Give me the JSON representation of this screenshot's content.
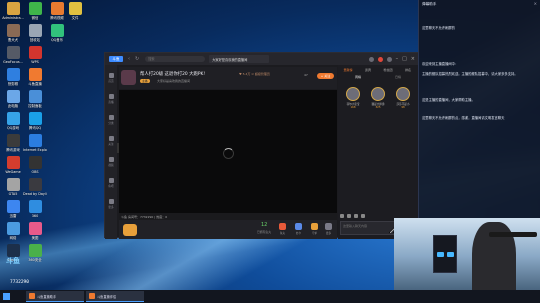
{
  "desktop": {
    "icons": [
      {
        "label": "Administra...",
        "color": "#d9a441"
      },
      {
        "label": "曹犬犬",
        "color": "#8a6a55"
      },
      {
        "label": "GeoFocus...",
        "color": "#555a66"
      },
      {
        "label": "快剪辑",
        "color": "#2f7fe0"
      },
      {
        "label": "此电脑",
        "color": "#6ba7e8"
      },
      {
        "label": "QQ游戏",
        "color": "#36a3e8"
      },
      {
        "label": "腾讯游戏",
        "color": "#3b3b3b"
      },
      {
        "label": "WeGame",
        "color": "#d33d2e"
      },
      {
        "label": "GTA5",
        "color": "#a4a4a4"
      },
      {
        "label": "迅雷",
        "color": "#3d86f0"
      },
      {
        "label": "网络",
        "color": "#4b9be0"
      },
      {
        "label": "Steam",
        "color": "#1c2f4a"
      },
      {
        "label": "微信",
        "color": "#3fb54a"
      },
      {
        "label": "回收站",
        "color": "#9aa6b4"
      },
      {
        "label": "WPS",
        "color": "#d3352e"
      },
      {
        "label": "斗鱼直播",
        "color": "#f07a30"
      },
      {
        "label": "控制面板",
        "color": "#4a8fd8"
      },
      {
        "label": "腾讯QQ",
        "color": "#1aa0e8"
      },
      {
        "label": "Internet Explorer",
        "color": "#2b7de0"
      },
      {
        "label": "OBS",
        "color": "#333"
      },
      {
        "label": "Dead by Daylight",
        "color": "#3a3a40"
      },
      {
        "label": "360",
        "color": "#2f8de0"
      },
      {
        "label": "美图",
        "color": "#e85a8a"
      },
      {
        "label": "360安全",
        "color": "#4ab04a"
      },
      {
        "label": "腾讯视频",
        "color": "#e87a30"
      },
      {
        "label": "QQ音乐",
        "color": "#31c27c"
      },
      {
        "label": "文件",
        "color": "#e0c040"
      }
    ]
  },
  "app": {
    "logo_label": "斗鱼",
    "search_placeholder": "搜索",
    "room_tab_label": "大家好是喜欢我的直播间",
    "leftnav": [
      "首页",
      "直播",
      "分类",
      "关注",
      "视频",
      "鱼吧",
      "更多"
    ],
    "room": {
      "title": "帮人打20级 这退你打20 大跑PK!",
      "meta": "♥ 5.4万  ⊙ 超级管理员",
      "tag": "主播",
      "host": "大家好是喜欢我的直播间",
      "follow_label": "+ 关注",
      "header_num": "47"
    },
    "video_info": "斗鱼 房间号：7732290 | 热度：0",
    "gift_bar": {
      "count": "12",
      "count_label": "已拥有鱼丸",
      "items": [
        {
          "label": "鱼丸",
          "color": "#e85a3a"
        },
        {
          "label": "办卡",
          "color": "#5a8ae8"
        },
        {
          "label": "守护",
          "color": "#e8a03a"
        },
        {
          "label": "更多",
          "color": "#7a7a88"
        }
      ]
    },
    "side_tabs": [
      "贡献榜",
      "贵宾",
      "粉丝团",
      "排名"
    ],
    "rank_tabs": [
      "周榜",
      "日榜"
    ],
    "podium": [
      {
        "name": "菲尔小宝宝",
        "score": "168"
      },
      {
        "name": "我是大鼻涕",
        "score": "325"
      },
      {
        "name": "莎莎不是小",
        "score": "98"
      }
    ],
    "chat_input_placeholder": "这里输入聊天内容",
    "send_label": "发送"
  },
  "overlay": {
    "title": "弹幕助手",
    "messages": [
      "这里聊天不允许刷屏的",
      "欢迎来到主播直播间中：",
      "主播的舰队招募热烈欢迎。主播的舰队招募中，请大家多多支持。",
      "这是主播的直播间，大家帮助主播。",
      "这里聊天不允许刷屏的点，感谢，直播间请文明发言聊天"
    ]
  },
  "stream_overlay": {
    "logo": "斗鱼",
    "room_number": "7732290"
  },
  "taskbar": {
    "items": [
      "斗鱼直播助手",
      "斗鱼直播伴侣"
    ]
  },
  "colors": {
    "accent": "#f07a30",
    "app_bg": "#1b1b1f"
  }
}
